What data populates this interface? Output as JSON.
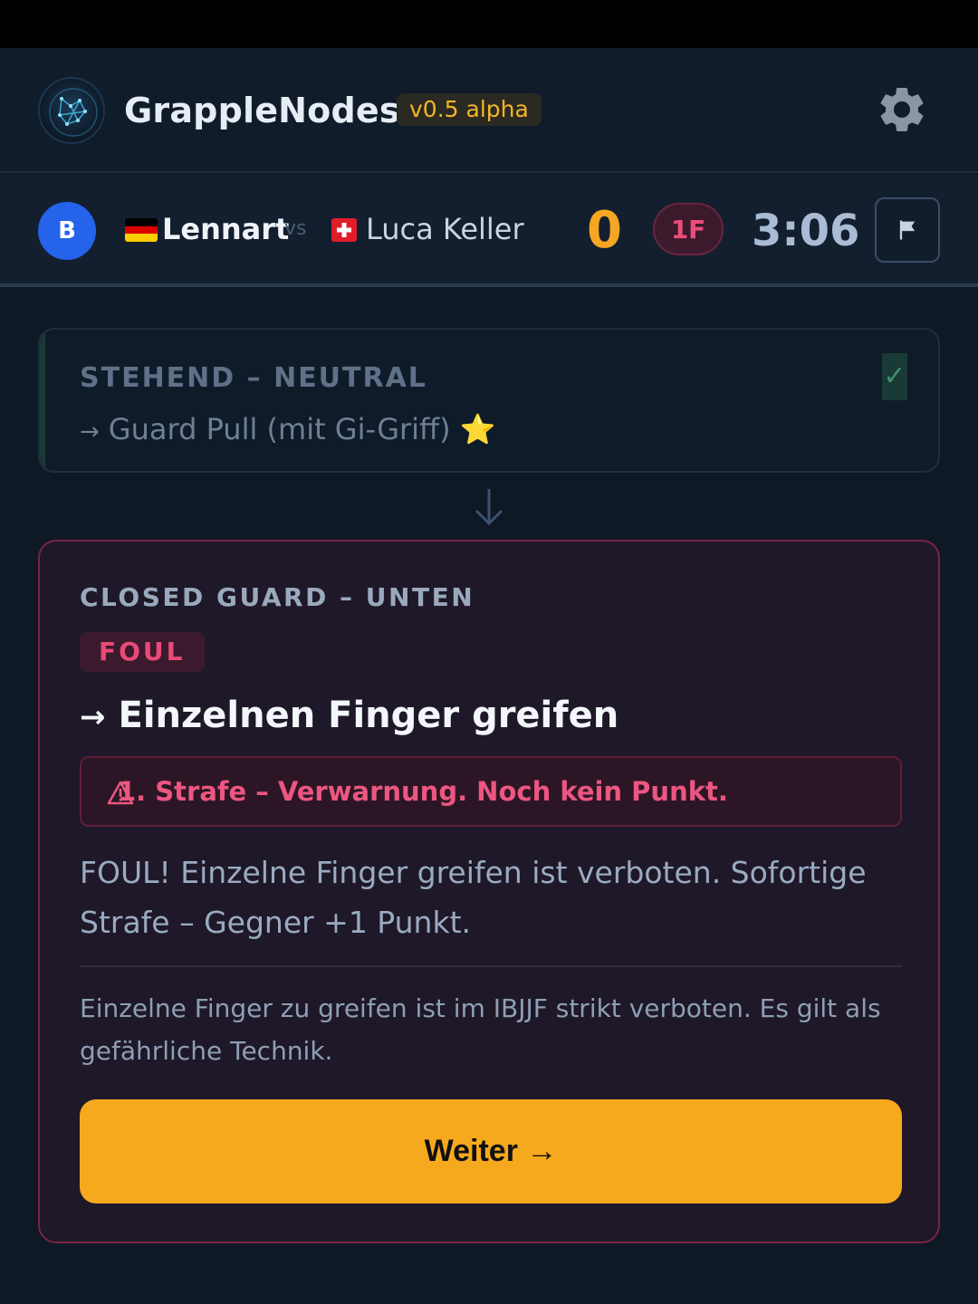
{
  "header": {
    "app_title": "GrappleNodes",
    "version": "v0.5 alpha",
    "settings_icon": "gear-icon"
  },
  "match": {
    "avatar_letter": "B",
    "player_a": "Lennart",
    "player_a_flag": "germany-flag",
    "vs": "vs",
    "player_b": "Luca Keller",
    "player_b_flag": "switzerland-flag",
    "score": "0",
    "fouls": "1F",
    "timer": "3:06",
    "flag_icon": "flag-icon"
  },
  "previous_step": {
    "position": "STEHEND – NEUTRAL",
    "arrow": "→",
    "move": "Guard Pull (mit Gi-Griff)",
    "star": "⭐",
    "check": "✓"
  },
  "current_step": {
    "position": "CLOSED GUARD – UNTEN",
    "tag": "FOUL",
    "arrow": "→",
    "move": "Einzelnen Finger greifen",
    "penalty": "1. Strafe – Verwarnung. Noch kein Punkt.",
    "explanation": "FOUL! Einzelne Finger greifen ist verboten. Sofortige Strafe – Gegner +1 Punkt.",
    "note": "Einzelne Finger zu greifen ist im IBJJF strikt verboten. Es gilt als gefährliche Technik.",
    "button": "Weiter →"
  },
  "colors": {
    "accent": "#f7a91e",
    "foul": "#ec4d7a",
    "background": "#0f1825"
  }
}
